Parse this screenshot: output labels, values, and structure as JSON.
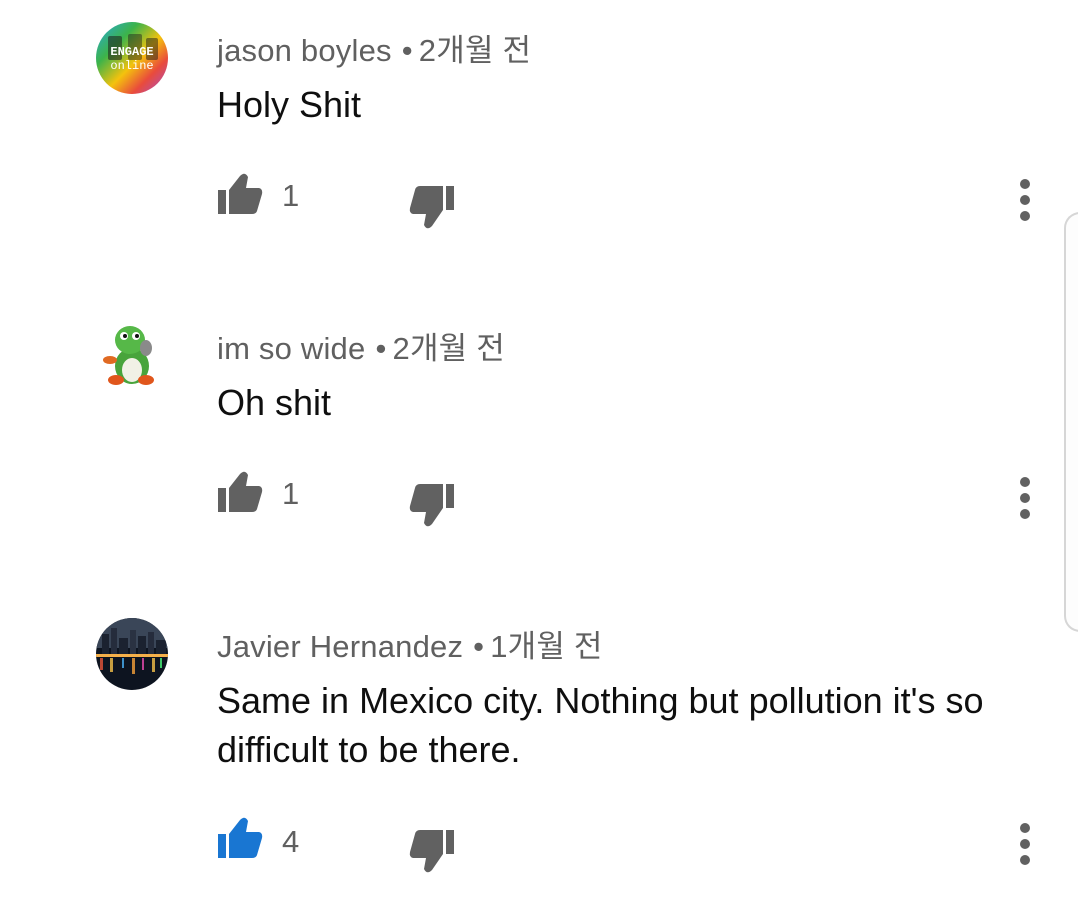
{
  "comments": [
    {
      "author": "jason boyles",
      "time": "2개월 전",
      "text": "Holy Shit",
      "likes": "1",
      "liked": false,
      "avatar_logo_line1": "ENGAGE",
      "avatar_logo_line2": "online"
    },
    {
      "author": "im so wide",
      "time": "2개월 전",
      "text": "Oh shit",
      "likes": "1",
      "liked": false
    },
    {
      "author": "Javier Hernandez",
      "time": "1개월 전",
      "text": "Same in Mexico city. Nothing but pollution it's so difficult to be there.",
      "likes": "4",
      "liked": true
    }
  ],
  "separator": "•",
  "colors": {
    "icon_gray": "#616161",
    "liked_blue": "#1976d2",
    "meta_text": "#606060",
    "body_text": "#0f0f0f"
  },
  "icons": {
    "like": "thumb-up-icon",
    "dislike": "thumb-down-icon",
    "more": "more-vert-icon"
  }
}
